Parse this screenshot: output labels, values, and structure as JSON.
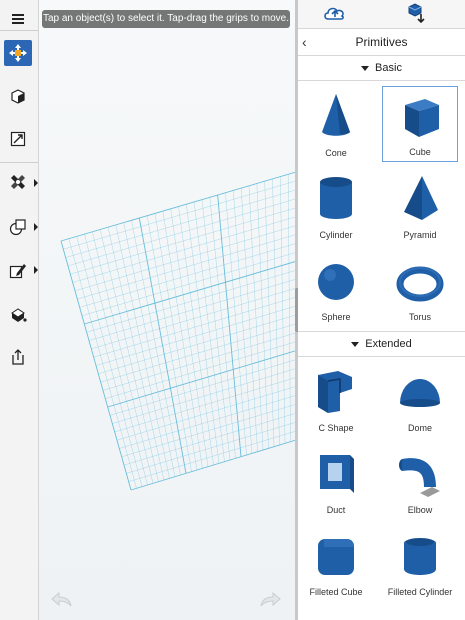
{
  "toolbar": {
    "menu_icon": "hamburger-menu-icon",
    "tools": [
      "move-icon",
      "materials-icon",
      "snap-icon",
      "construct-icon",
      "combine-icon",
      "sketch-icon",
      "paint-icon",
      "share-icon"
    ]
  },
  "viewport": {
    "hint": "Tap an object(s) to select it. Tap-drag the grips to move."
  },
  "panel": {
    "title": "Primitives",
    "sections": [
      {
        "name": "Basic",
        "items": [
          {
            "label": "Cone",
            "icon": "cone-icon",
            "selected": false
          },
          {
            "label": "Cube",
            "icon": "cube-icon",
            "selected": true
          },
          {
            "label": "Cylinder",
            "icon": "cylinder-icon",
            "selected": false
          },
          {
            "label": "Pyramid",
            "icon": "pyramid-icon",
            "selected": false
          },
          {
            "label": "Sphere",
            "icon": "sphere-icon",
            "selected": false
          },
          {
            "label": "Torus",
            "icon": "torus-icon",
            "selected": false
          }
        ]
      },
      {
        "name": "Extended",
        "items": [
          {
            "label": "C Shape",
            "icon": "c-shape-icon",
            "selected": false
          },
          {
            "label": "Dome",
            "icon": "dome-icon",
            "selected": false
          },
          {
            "label": "Duct",
            "icon": "duct-icon",
            "selected": false
          },
          {
            "label": "Elbow",
            "icon": "elbow-icon",
            "selected": false
          },
          {
            "label": "Filleted Cube",
            "icon": "filleted-cube-icon",
            "selected": false
          },
          {
            "label": "Filleted Cylinder",
            "icon": "filleted-cylinder-icon",
            "selected": false
          }
        ]
      }
    ]
  },
  "colors": {
    "accent": "#2c67b5",
    "shape_blue": "#1f5fa8",
    "grid": "#5ab8d8"
  }
}
